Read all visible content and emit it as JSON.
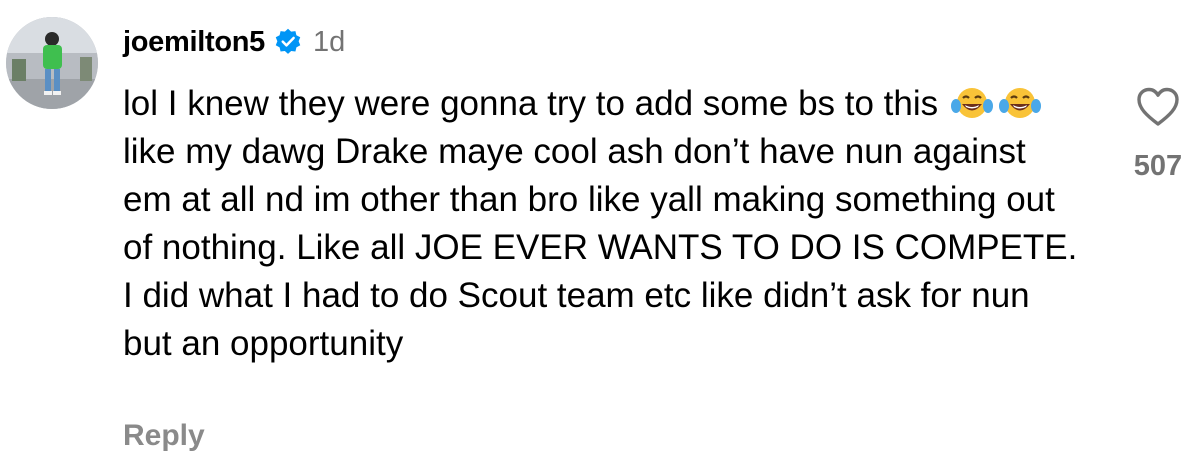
{
  "comment": {
    "username": "joemilton5",
    "verified_icon": "verified-badge-icon",
    "timestamp": "1d",
    "text_part1": "lol I knew they were gonna try to add some bs to this",
    "emoji": [
      "😂",
      "😂"
    ],
    "text_part2": "like my dawg Drake maye cool ash don’t have nun against em at all nd im other than bro like yall making something out of nothing. Like all JOE EVER WANTS TO DO IS COMPETE. I did what I had to do Scout team etc like didn’t ask for nun but an opportunity",
    "reply_label": "Reply",
    "like_count": "507",
    "like_icon": "heart-outline-icon"
  },
  "colors": {
    "username": "#000000",
    "timestamp": "#737373",
    "reply": "#8a8a8a",
    "verified": "#0095f6",
    "like_count": "#737373"
  }
}
